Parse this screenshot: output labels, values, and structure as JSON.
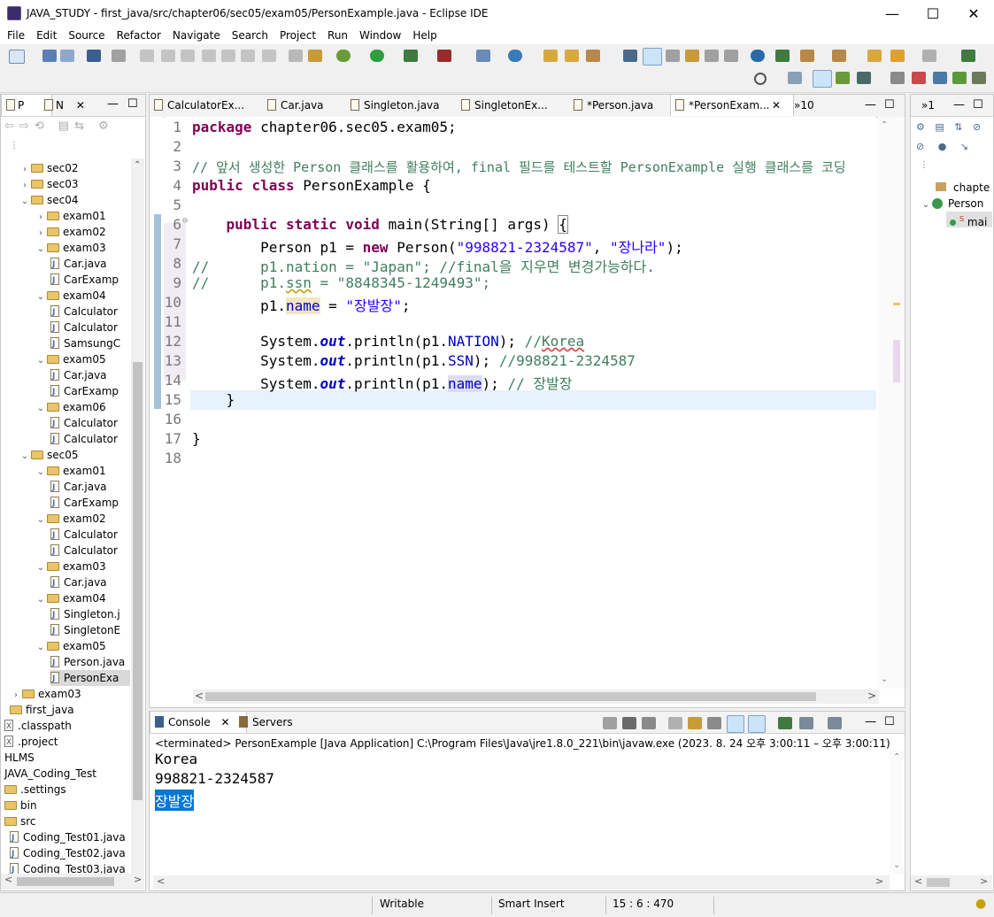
{
  "window": {
    "title": "JAVA_STUDY - first_java/src/chapter06/sec05/exam05/PersonExample.java - Eclipse IDE"
  },
  "menu": [
    "File",
    "Edit",
    "Source",
    "Refactor",
    "Navigate",
    "Search",
    "Project",
    "Run",
    "Window",
    "Help"
  ],
  "left_panel": {
    "tabs": [
      "P",
      "N"
    ],
    "tree": [
      {
        "label": "sec02",
        "kind": "folder",
        "caret": "›",
        "indent": 0
      },
      {
        "label": "sec03",
        "kind": "folder",
        "caret": "›",
        "indent": 0
      },
      {
        "label": "sec04",
        "kind": "folder",
        "caret": "⌄",
        "indent": 0
      },
      {
        "label": "exam01",
        "kind": "folder",
        "caret": "›",
        "indent": 1
      },
      {
        "label": "exam02",
        "kind": "folder",
        "caret": "›",
        "indent": 1
      },
      {
        "label": "exam03",
        "kind": "folder",
        "caret": "⌄",
        "indent": 1
      },
      {
        "label": "Car.java",
        "kind": "java",
        "caret": "",
        "indent": 2
      },
      {
        "label": "CarExamp",
        "kind": "java",
        "caret": "",
        "indent": 2
      },
      {
        "label": "exam04",
        "kind": "folder",
        "caret": "⌄",
        "indent": 1
      },
      {
        "label": "Calculator",
        "kind": "java",
        "caret": "",
        "indent": 2
      },
      {
        "label": "Calculator",
        "kind": "java",
        "caret": "",
        "indent": 2
      },
      {
        "label": "SamsungC",
        "kind": "java",
        "caret": "",
        "indent": 2
      },
      {
        "label": "exam05",
        "kind": "folder",
        "caret": "⌄",
        "indent": 1
      },
      {
        "label": "Car.java",
        "kind": "java",
        "caret": "",
        "indent": 2
      },
      {
        "label": "CarExamp",
        "kind": "java",
        "caret": "",
        "indent": 2
      },
      {
        "label": "exam06",
        "kind": "folder",
        "caret": "⌄",
        "indent": 1
      },
      {
        "label": "Calculator",
        "kind": "java",
        "caret": "",
        "indent": 2
      },
      {
        "label": "Calculator",
        "kind": "java",
        "caret": "",
        "indent": 2
      },
      {
        "label": "sec05",
        "kind": "folder",
        "caret": "⌄",
        "indent": 0
      },
      {
        "label": "exam01",
        "kind": "folder",
        "caret": "⌄",
        "indent": 1
      },
      {
        "label": "Car.java",
        "kind": "java",
        "caret": "",
        "indent": 2
      },
      {
        "label": "CarExamp",
        "kind": "java",
        "caret": "",
        "indent": 2
      },
      {
        "label": "exam02",
        "kind": "folder",
        "caret": "⌄",
        "indent": 1
      },
      {
        "label": "Calculator",
        "kind": "java",
        "caret": "",
        "indent": 2
      },
      {
        "label": "Calculator",
        "kind": "java",
        "caret": "",
        "indent": 2
      },
      {
        "label": "exam03",
        "kind": "folder",
        "caret": "⌄",
        "indent": 1
      },
      {
        "label": "Car.java",
        "kind": "java",
        "caret": "",
        "indent": 2
      },
      {
        "label": "exam04",
        "kind": "folder",
        "caret": "⌄",
        "indent": 1
      },
      {
        "label": "Singleton.j",
        "kind": "java",
        "caret": "",
        "indent": 2
      },
      {
        "label": "SingletonE",
        "kind": "java",
        "caret": "",
        "indent": 2
      },
      {
        "label": "exam05",
        "kind": "folder",
        "caret": "⌄",
        "indent": 1
      },
      {
        "label": "Person.java",
        "kind": "java",
        "caret": "",
        "indent": 2
      },
      {
        "label": "PersonExa",
        "kind": "java",
        "caret": "",
        "indent": 2,
        "selected": true
      },
      {
        "label": "exam03",
        "kind": "folder",
        "caret": "›",
        "indent": -1
      },
      {
        "label": "first_java",
        "kind": "folder",
        "caret": "",
        "indent": -1
      },
      {
        "label": ".classpath",
        "kind": "xml",
        "caret": "",
        "indent": -2
      },
      {
        "label": ".project",
        "kind": "xml",
        "caret": "",
        "indent": -2
      },
      {
        "label": "HLMS",
        "kind": "project",
        "caret": "",
        "indent": -3
      },
      {
        "label": "JAVA_Coding_Test",
        "kind": "project",
        "caret": "",
        "indent": -3
      },
      {
        "label": ".settings",
        "kind": "folder",
        "caret": "",
        "indent": -2
      },
      {
        "label": "bin",
        "kind": "folder",
        "caret": "",
        "indent": -2
      },
      {
        "label": "src",
        "kind": "folder",
        "caret": "",
        "indent": -2
      },
      {
        "label": "Coding_Test01.java",
        "kind": "java",
        "caret": "",
        "indent": -1
      },
      {
        "label": "Coding_Test02.java",
        "kind": "java",
        "caret": "",
        "indent": -1
      },
      {
        "label": "Coding_Test03.java",
        "kind": "java",
        "caret": "",
        "indent": -1
      }
    ]
  },
  "editor": {
    "tabs": [
      "CalculatorEx...",
      "Car.java",
      "Singleton.java",
      "SingletonEx...",
      "*Person.java",
      "*PersonExam..."
    ],
    "overflow": "»10",
    "line_numbers": [
      "1",
      "2",
      "3",
      "4",
      "5",
      "6",
      "7",
      "8",
      "9",
      "10",
      "11",
      "12",
      "13",
      "14",
      "15",
      "16",
      "17",
      "18"
    ]
  },
  "right_panel": {
    "overflow": "»1",
    "outline": [
      "chapte",
      "Person",
      "mai"
    ]
  },
  "console": {
    "tabs": [
      "Console",
      "Servers"
    ],
    "header": "<terminated> PersonExample [Java Application] C:\\Program Files\\Java\\jre1.8.0_221\\bin\\javaw.exe  (2023. 8. 24 오후 3:00:11 – 오후 3:00:11)",
    "output": [
      "Korea",
      "998821-2324587",
      "장발장"
    ]
  },
  "status": {
    "mode": "Writable",
    "insert": "Smart Insert",
    "position": "15 : 6 : 470"
  }
}
